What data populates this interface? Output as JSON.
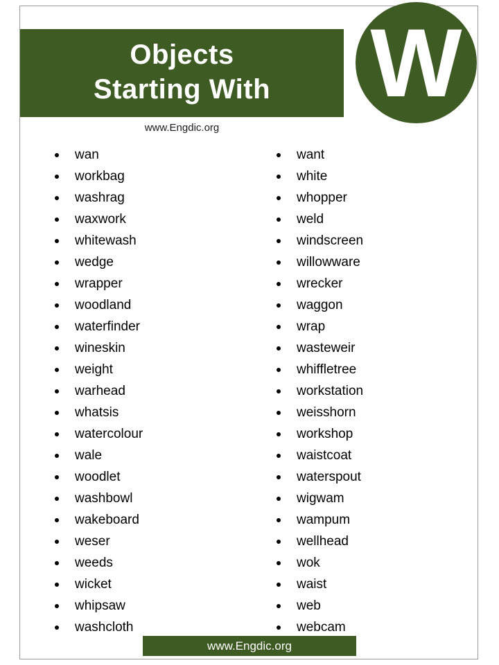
{
  "header": {
    "title_line1": "Objects",
    "title_line2": "Starting With",
    "logo_letter": "W",
    "subtitle": "www.Engdic.org",
    "band_color": "#3d5b22",
    "title_color": "#ffffff"
  },
  "footer": {
    "text": "www.Engdic.org",
    "band_color": "#3d5b22"
  },
  "columns": [
    {
      "items": [
        "wan",
        "workbag",
        "washrag",
        "waxwork",
        "whitewash",
        "wedge",
        "wrapper",
        "woodland",
        "waterfinder",
        "wineskin",
        "weight",
        "warhead",
        "whatsis",
        "watercolour",
        "wale",
        "woodlet",
        "washbowl",
        "wakeboard",
        "weser",
        "weeds",
        "wicket",
        "whipsaw",
        "washcloth"
      ]
    },
    {
      "items": [
        "want",
        "white",
        "whopper",
        "weld",
        "windscreen",
        "willowware",
        "wrecker",
        "waggon",
        "wrap",
        "wasteweir",
        "whiffletree",
        "workstation",
        "weisshorn",
        "workshop",
        "waistcoat",
        "waterspout",
        "wigwam",
        "wampum",
        "wellhead",
        "wok",
        "waist",
        "web",
        "webcam"
      ]
    }
  ]
}
